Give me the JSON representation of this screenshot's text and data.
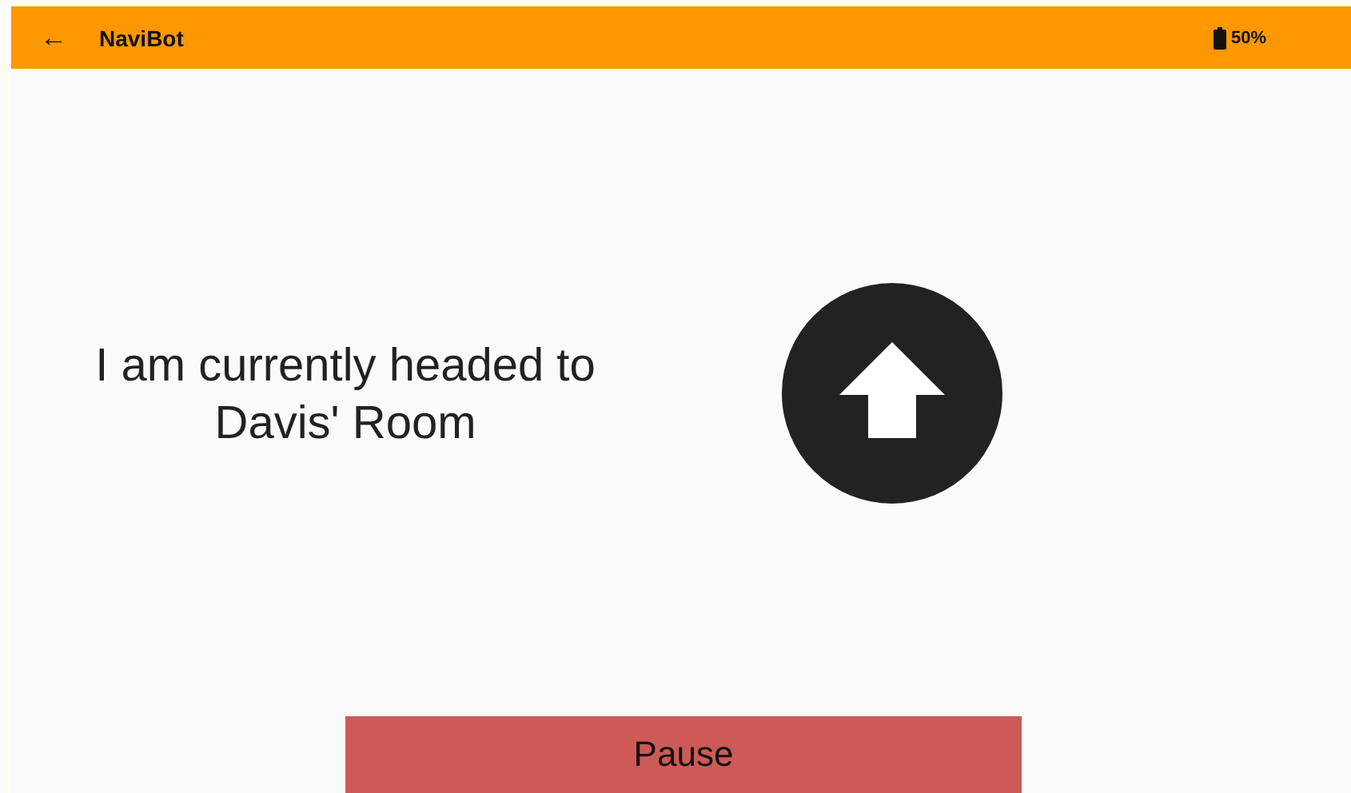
{
  "app_bar": {
    "back_icon": "←",
    "title": "NaviBot",
    "battery": "50%"
  },
  "message": {
    "line_1": "I am currently headed to",
    "line_2": "Davis' Room"
  },
  "direction": {
    "kind": "up"
  },
  "button": {
    "label": "Pause"
  }
}
